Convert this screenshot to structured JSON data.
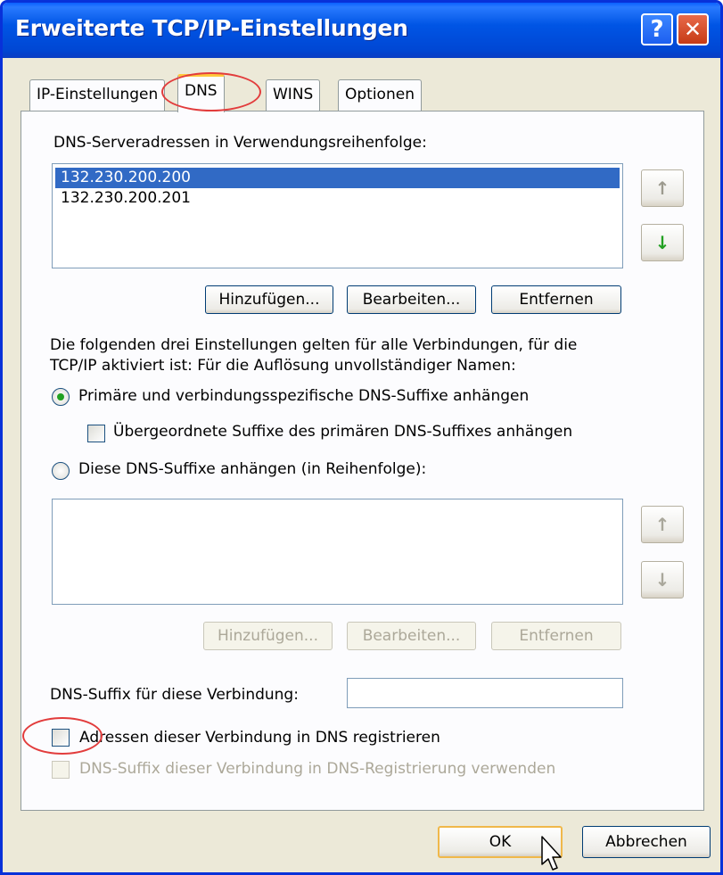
{
  "window": {
    "title": "Erweiterte TCP/IP-Einstellungen",
    "help_glyph": "?",
    "close_glyph": "✕"
  },
  "tabs": [
    {
      "label": "IP-Einstellungen",
      "active": false
    },
    {
      "label": "DNS",
      "active": true
    },
    {
      "label": "WINS",
      "active": false
    },
    {
      "label": "Optionen",
      "active": false
    }
  ],
  "dns": {
    "server_list_label": "DNS-Serveradressen in Verwendungsreihenfolge:",
    "servers": [
      "132.230.200.200",
      "132.230.200.201"
    ],
    "selected_index": 0,
    "buttons": {
      "add": "Hinzufügen...",
      "edit": "Bearbeiten...",
      "remove": "Entfernen"
    },
    "info_text_line1": "Die folgenden drei Einstellungen gelten für alle Verbindungen, für die",
    "info_text_line2": "TCP/IP aktiviert ist: Für die Auflösung unvollständiger Namen:",
    "radio_primary": "Primäre und verbindungsspezifische DNS-Suffixe anhängen",
    "radio_primary_selected": true,
    "checkbox_parent_suffix": "Übergeordnete Suffixe des primären DNS-Suffixes anhängen",
    "checkbox_parent_suffix_checked": false,
    "radio_these_suffixes": "Diese DNS-Suffixe anhängen (in Reihenfolge):",
    "suffix_buttons": {
      "add": "Hinzufügen...",
      "edit": "Bearbeiten...",
      "remove": "Entfernen"
    },
    "connection_suffix_label": "DNS-Suffix für diese Verbindung:",
    "connection_suffix_value": "",
    "register_checkbox": "Adressen dieser Verbindung in DNS registrieren",
    "register_checked": false,
    "use_suffix_checkbox": "DNS-Suffix dieser Verbindung in DNS-Registrierung verwenden",
    "use_suffix_checked": false
  },
  "footer": {
    "ok": "OK",
    "cancel": "Abbrechen"
  },
  "icons": {
    "up_arrow": "arrow-up-icon",
    "down_arrow": "arrow-down-icon"
  },
  "colors": {
    "titlebar": "#0055e5",
    "selection": "#316ac5",
    "highlight_annotation": "#e23c3c"
  }
}
